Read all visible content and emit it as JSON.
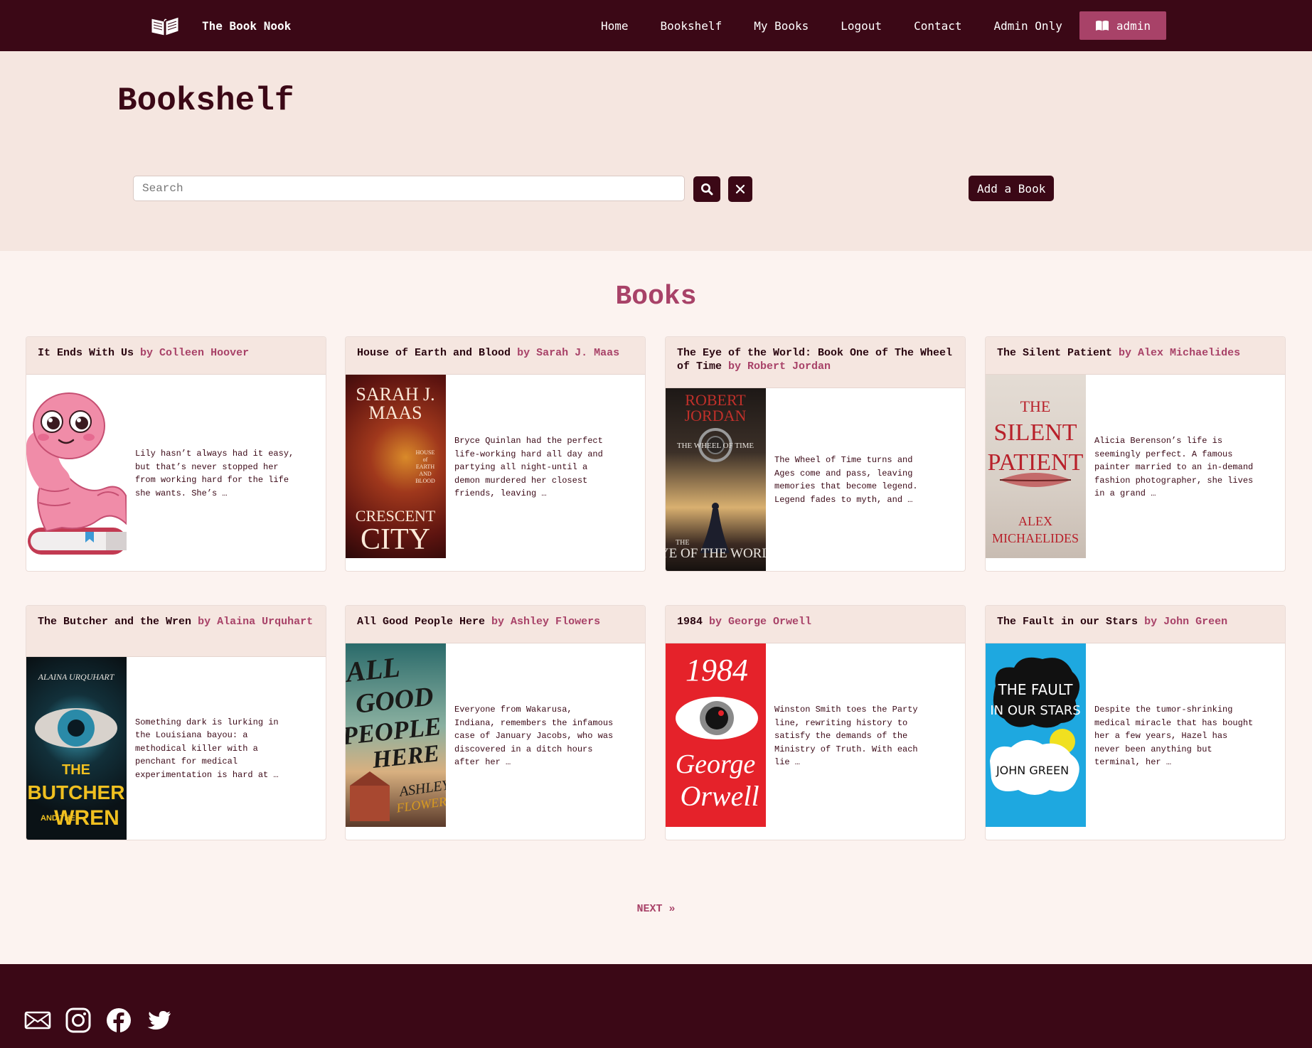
{
  "nav": {
    "brand": "The Book Nook",
    "links": [
      "Home",
      "Bookshelf",
      "My Books",
      "Logout",
      "Contact",
      "Admin Only"
    ],
    "user": "admin"
  },
  "page": {
    "title": "Bookshelf",
    "search_placeholder": "Search",
    "search_value": "",
    "add_label": "Add a Book",
    "section_title": "Books",
    "next_label": "NEXT »"
  },
  "books": [
    {
      "title": "It Ends With Us",
      "by": "by Colleen Hoover",
      "desc": "Lily hasn’t always had it easy, but that’s never stopped her from working hard for the life she wants. She’s …",
      "cover": "placeholder-bookworm"
    },
    {
      "title": "House of Earth and Blood",
      "by": "by Sarah J. Maas",
      "desc": "Bryce Quinlan had the perfect life-working hard all day and partying all night-until a demon murdered her closest friends, leaving …",
      "cover_lines": [
        "SARAH J.",
        "MAAS",
        "CRESCENT",
        "CITY"
      ],
      "cover_small": [
        "HOUSE",
        "of",
        "EARTH",
        "AND",
        "BLOOD"
      ]
    },
    {
      "title": "The Eye of the World: Book One of The Wheel of Time",
      "by": "by Robert Jordan",
      "desc": "The Wheel of Time turns and Ages come and pass, leaving memories that become legend. Legend fades to myth, and …",
      "cover_lines": [
        "ROBERT",
        "JORDAN",
        "THE WHEEL OF TIME",
        "THE",
        "EYE OF THE WORLD"
      ]
    },
    {
      "title": "The Silent Patient",
      "by": "by Alex Michaelides",
      "desc": "Alicia Berenson’s life is seemingly perfect. A famous painter married to an in-demand fashion photographer, she lives in a grand …",
      "cover_lines": [
        "THE",
        "SILENT",
        "PATIENT",
        "ALEX",
        "MICHAELIDES"
      ]
    },
    {
      "title": "The Butcher and the Wren",
      "by": "by Alaina Urquhart",
      "desc": "Something dark is lurking in the Louisiana bayou: a methodical killer with a penchant for medical experimentation is hard at …",
      "cover_lines": [
        "ALAINA URQUHART",
        "THE",
        "BUTCHER",
        "AND THE",
        "WREN"
      ]
    },
    {
      "title": "All Good People Here",
      "by": "by Ashley Flowers",
      "desc": "Everyone from Wakarusa, Indiana, remembers the infamous case of January Jacobs, who was discovered in a ditch hours after her …",
      "cover_lines": [
        "ALL",
        "GOOD",
        "PEOPLE",
        "HERE",
        "ASHLEY",
        "FLOWERS"
      ]
    },
    {
      "title": "1984",
      "by": "by George Orwell",
      "desc": "Winston Smith toes the Party line, rewriting history to satisfy the demands of the Ministry of Truth. With each lie …",
      "cover_lines": [
        "1984",
        "George",
        "Orwell"
      ]
    },
    {
      "title": "The Fault in our Stars",
      "by": "by John Green",
      "desc": "Despite the tumor-shrinking medical miracle that has bought her a few years, Hazel has never been anything but terminal, her …",
      "cover_lines": [
        "THE FAULT",
        "IN OUR STARS",
        "JOHN GREEN"
      ]
    }
  ],
  "footer": {
    "icons": [
      "mail-icon",
      "instagram-icon",
      "facebook-icon",
      "twitter-icon"
    ]
  },
  "colors": {
    "primary": "#3b0816",
    "accent": "#a84268",
    "band": "#f5e6e0",
    "background": "#fcf3f0"
  }
}
